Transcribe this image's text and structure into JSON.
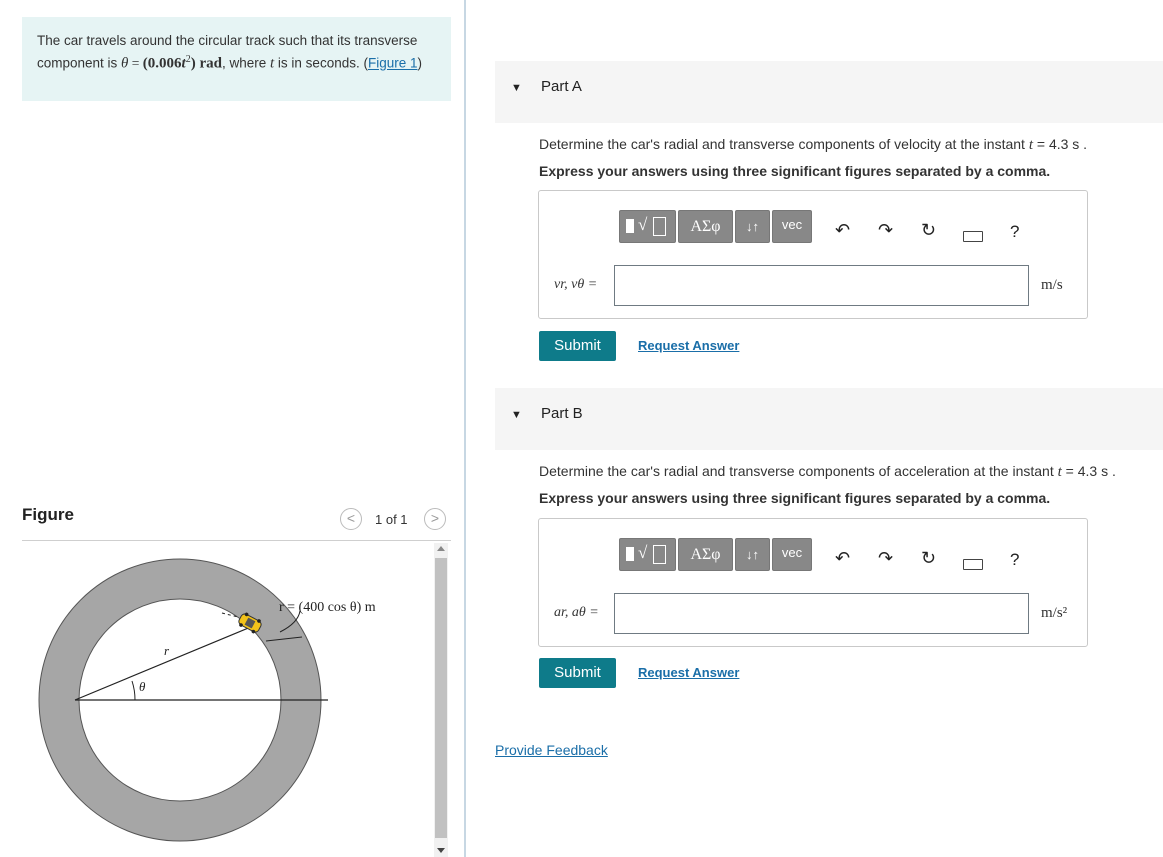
{
  "problem": {
    "text_before": "The car travels around the circular track such that its transverse component is ",
    "equation_theta": "θ",
    "equation_equals": " = ",
    "equation_value": "(0.006",
    "equation_t": "t",
    "equation_exp": "2",
    "equation_close": ")",
    "equation_unit": " rad",
    "text_where": ", where ",
    "var_t": "t",
    "text_after": " is in seconds. (",
    "figure_link": "Figure 1",
    "text_close": ")"
  },
  "figure": {
    "heading": "Figure",
    "pager_prev": "<",
    "pager_text": "1 of 1",
    "pager_next": ">",
    "label_r_eq": "r = (400 cos θ) m",
    "label_r": "r",
    "label_theta": "θ"
  },
  "parts": [
    {
      "title": "Part A",
      "toggle": "▼",
      "question_before": "Determine the car's radial and transverse components of velocity at the instant ",
      "question_var": "t",
      "question_after": " = 4.3  s .",
      "instruction": "Express your answers using three significant figures separated by a comma.",
      "answer_label": "vr, vθ =",
      "answer_value": "",
      "unit": "m/s",
      "submit": "Submit",
      "request": "Request Answer"
    },
    {
      "title": "Part B",
      "toggle": "▼",
      "question_before": "Determine the car's radial and transverse components of acceleration at the instant ",
      "question_var": "t",
      "question_after": " = 4.3  s .",
      "instruction": "Express your answers using three significant figures separated by a comma.",
      "answer_label": "ar, aθ =",
      "answer_value": "",
      "unit": "m/s²",
      "submit": "Submit",
      "request": "Request Answer"
    }
  ],
  "toolbar": {
    "greek": "ΑΣφ",
    "arrows": "↓↑",
    "vec": "vec",
    "help": "?",
    "icons": [
      "templates-icon",
      "greek-icon",
      "subscript-icon",
      "vector-icon",
      "undo-icon",
      "redo-icon",
      "reset-icon",
      "keyboard-icon",
      "help-icon"
    ]
  },
  "feedback": "Provide Feedback",
  "colors": {
    "problem_bg": "#e6f4f4",
    "submit_bg": "#0e7b8a",
    "link": "#1a6ea8",
    "part_header_bg": "#f5f5f5",
    "ring_fill": "#a6a6a6"
  }
}
